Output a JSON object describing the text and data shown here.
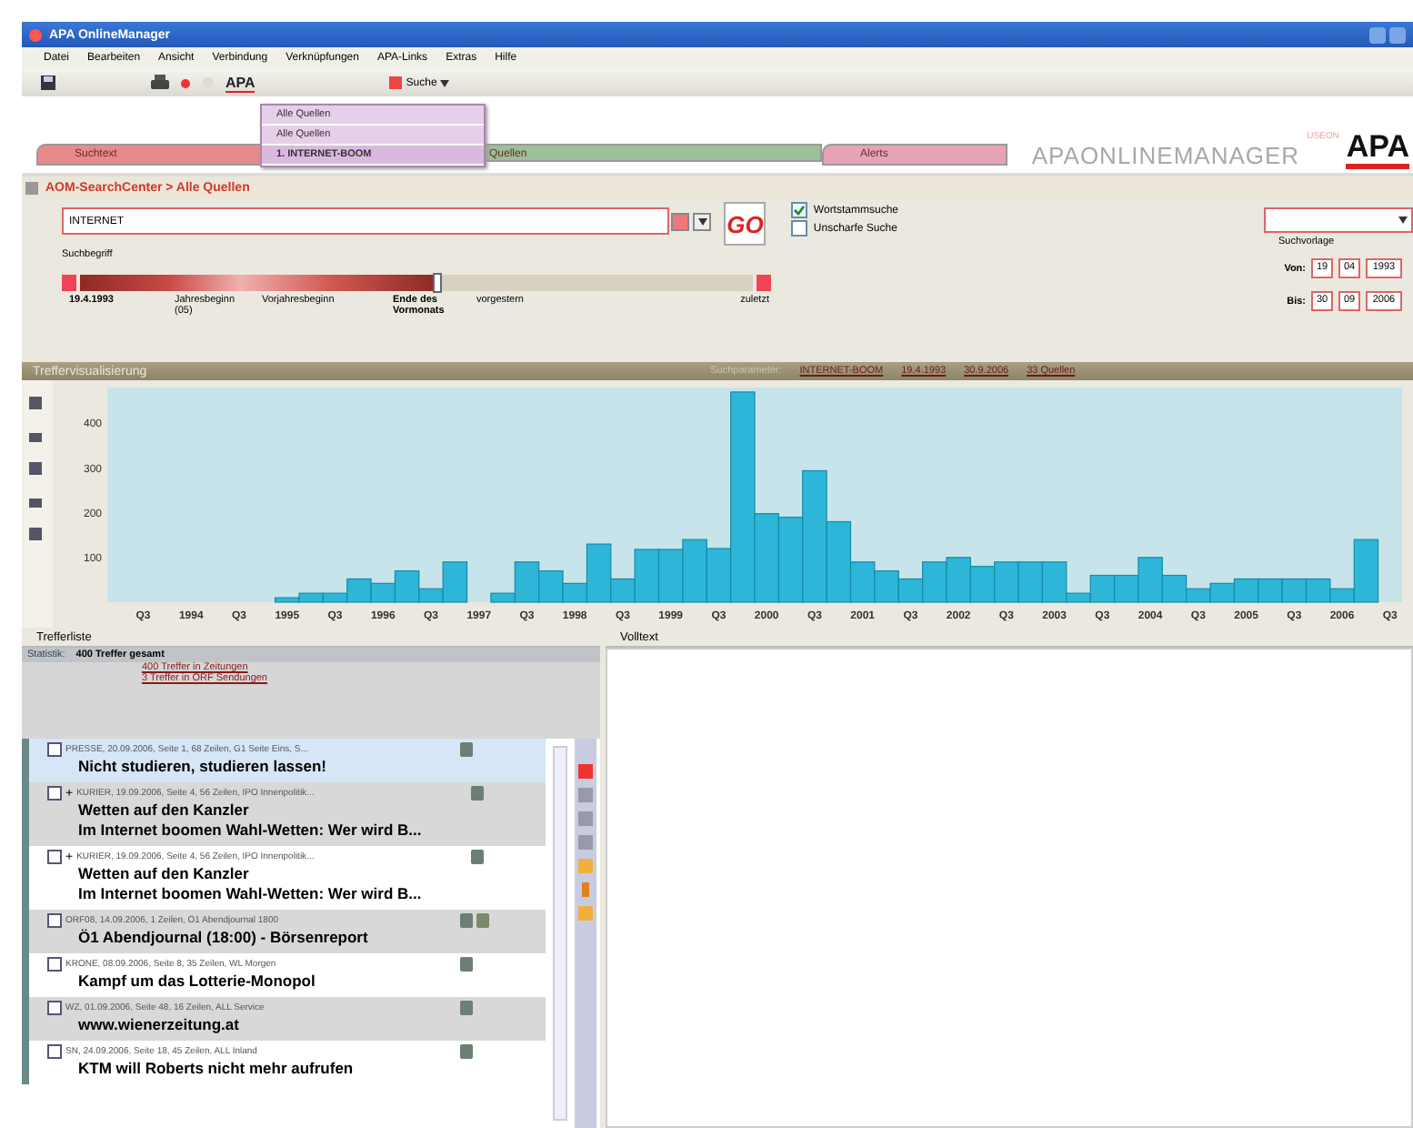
{
  "window": {
    "title": "APA OnlineManager"
  },
  "menu": [
    "Datei",
    "Bearbeiten",
    "Ansicht",
    "Verbindung",
    "Verknüpfungen",
    "APA-Links",
    "Extras",
    "Hilfe"
  ],
  "toolbar": {
    "logo": "APA",
    "search_button": "Suche"
  },
  "dropdown": {
    "items": [
      "Alle Quellen",
      "Alle Quellen",
      "1. INTERNET-BOOM"
    ]
  },
  "tabs": [
    {
      "label": "Suchtext",
      "color": "#e88a8a"
    },
    {
      "label": "Quellen",
      "color": "#9dbf9a"
    },
    {
      "label": "Alerts",
      "color": "#e6a3b4"
    }
  ],
  "brand": {
    "wordmark": "APAONLINEMANAGER",
    "edition": "USEON",
    "logo": "APA"
  },
  "search": {
    "breadcrumb": "AOM-SearchCenter > Alle Quellen",
    "query": "INTERNET",
    "query_label": "Suchbegriff",
    "go": "GO",
    "options": [
      {
        "label": "Wortstammsuche",
        "checked": true
      },
      {
        "label": "Unscharfe Suche",
        "checked": false
      }
    ],
    "range": {
      "level": 0.53,
      "labels": [
        {
          "text": "19.4.1993",
          "bold": true
        },
        {
          "text": "Jahresbeginn (05)",
          "bold": false
        },
        {
          "text": "Vorjahresbeginn",
          "bold": false
        },
        {
          "text": "Ende des Vormonats",
          "bold": true
        },
        {
          "text": "vorgestern",
          "bold": false
        },
        {
          "text": "zuletzt",
          "bold": false
        }
      ]
    },
    "template_label": "Suchvorlage",
    "dates": [
      {
        "label": "Von:",
        "day": "19",
        "month": "04",
        "year": "1993"
      },
      {
        "label": "Bis:",
        "day": "30",
        "month": "09",
        "year": "2006"
      }
    ]
  },
  "chart_panel": {
    "title": "Treffervisualisierung",
    "params_label": "Suchparameter:",
    "params": [
      "INTERNET-BOOM",
      "19.4.1993",
      "30.9.2006",
      "33 Quellen"
    ],
    "chart_data": {
      "type": "bar",
      "xlim": [
        1993.125,
        2006.625
      ],
      "ylim": [
        0,
        480
      ],
      "yticks": [
        100,
        200,
        300,
        400
      ],
      "x": [
        1995,
        1995.25,
        1995.5,
        1995.75,
        1996,
        1996.25,
        1996.5,
        1996.75,
        1997,
        1997.25,
        1997.5,
        1997.75,
        1998,
        1998.25,
        1998.5,
        1998.75,
        1999,
        1999.25,
        1999.5,
        1999.75,
        2000,
        2000.25,
        2000.5,
        2000.75,
        2001,
        2001.25,
        2001.5,
        2001.75,
        2002,
        2002.25,
        2002.5,
        2002.75,
        2003,
        2003.25,
        2003.5,
        2003.75,
        2004,
        2004.25,
        2004.5,
        2004.75,
        2005,
        2005.25,
        2005.5,
        2005.75,
        2006,
        2006.25
      ],
      "values": [
        10,
        20,
        20,
        52,
        42,
        70,
        30,
        90,
        null,
        20,
        90,
        70,
        42,
        130,
        52,
        118,
        118,
        140,
        120,
        470,
        198,
        190,
        294,
        180,
        90,
        70,
        52,
        90,
        100,
        80,
        90,
        90,
        90,
        20,
        60,
        60,
        100,
        60,
        30,
        42,
        52,
        52,
        52,
        52,
        30,
        140
      ],
      "xticks": [
        {
          "value": 1993.5,
          "label": "Q3"
        },
        {
          "value": 1994,
          "label": "1994"
        },
        {
          "value": 1994.5,
          "label": "Q3"
        },
        {
          "value": 1995,
          "label": "1995"
        },
        {
          "value": 1995.5,
          "label": "Q3"
        },
        {
          "value": 1996,
          "label": "1996"
        },
        {
          "value": 1996.5,
          "label": "Q3"
        },
        {
          "value": 1997,
          "label": "1997"
        },
        {
          "value": 1997.5,
          "label": "Q3"
        },
        {
          "value": 1998,
          "label": "1998"
        },
        {
          "value": 1998.5,
          "label": "Q3"
        },
        {
          "value": 1999,
          "label": "1999"
        },
        {
          "value": 1999.5,
          "label": "Q3"
        },
        {
          "value": 2000,
          "label": "2000"
        },
        {
          "value": 2000.5,
          "label": "Q3"
        },
        {
          "value": 2001,
          "label": "2001"
        },
        {
          "value": 2001.5,
          "label": "Q3"
        },
        {
          "value": 2002,
          "label": "2002"
        },
        {
          "value": 2002.5,
          "label": "Q3"
        },
        {
          "value": 2003,
          "label": "2003"
        },
        {
          "value": 2003.5,
          "label": "Q3"
        },
        {
          "value": 2004,
          "label": "2004"
        },
        {
          "value": 2004.5,
          "label": "Q3"
        },
        {
          "value": 2005,
          "label": "2005"
        },
        {
          "value": 2005.5,
          "label": "Q3"
        },
        {
          "value": 2006,
          "label": "2006"
        },
        {
          "value": 2006.5,
          "label": "Q3"
        }
      ]
    }
  },
  "results": {
    "title": "Trefferliste",
    "stats_label": "Statistik:",
    "stats": "400 Treffer gesamt",
    "links": [
      "400 Treffer in Zeitungen",
      "3 Treffer in ORF Sendungen"
    ],
    "items": [
      {
        "source": "PRESSE, 20.09.2006, Seite 1, 68 Zeilen, G1 Seite Eins, S...",
        "headlines": [
          "Nicht studieren, studieren lassen!"
        ],
        "selected": true,
        "docs": [
          {
            "kind": "text"
          }
        ]
      },
      {
        "source": "KURIER, 19.09.2006, Seite 4, 56 Zeilen, IPO Innenpolitik...",
        "plus": "+",
        "headlines": [
          "Wetten auf den Kanzler",
          "Im Internet boomen Wahl-Wetten: Wer wird B..."
        ],
        "selected": false,
        "docs": [
          {
            "kind": "text"
          }
        ]
      },
      {
        "source": "KURIER, 19.09.2006, Seite 4, 56 Zeilen, IPO Innenpolitik...",
        "plus": "+",
        "headlines": [
          "Wetten auf den Kanzler",
          "Im Internet boomen Wahl-Wetten: Wer wird B..."
        ],
        "selected": false,
        "docs": [
          {
            "kind": "text"
          }
        ]
      },
      {
        "source": "ORF08, 14.09.2006, 1 Zeilen, Ö1 Abendjournal 1800",
        "headlines": [
          "Ö1 Abendjournal (18:00) - Börsenreport"
        ],
        "selected": false,
        "docs": [
          {
            "kind": "text"
          },
          {
            "kind": "audio"
          }
        ]
      },
      {
        "source": "KRONE, 08.09.2006, Seite 8, 35 Zeilen, WL Morgen",
        "headlines": [
          "Kampf um das Lotterie-Monopol"
        ],
        "selected": false,
        "docs": [
          {
            "kind": "text"
          }
        ]
      },
      {
        "source": "WZ, 01.09.2006, Seite 48, 16 Zeilen, ALL Service",
        "headlines": [
          "www.wienerzeitung.at"
        ],
        "selected": false,
        "docs": [
          {
            "kind": "text"
          }
        ]
      },
      {
        "source": "SN, 24.09.2006, Seite 18, 45 Zeilen, ALL Inland",
        "headlines": [
          "KTM will Roberts nicht mehr aufrufen"
        ],
        "selected": false,
        "docs": [
          {
            "kind": "text"
          }
        ]
      }
    ]
  },
  "fulltext": {
    "title": "Volltext"
  }
}
